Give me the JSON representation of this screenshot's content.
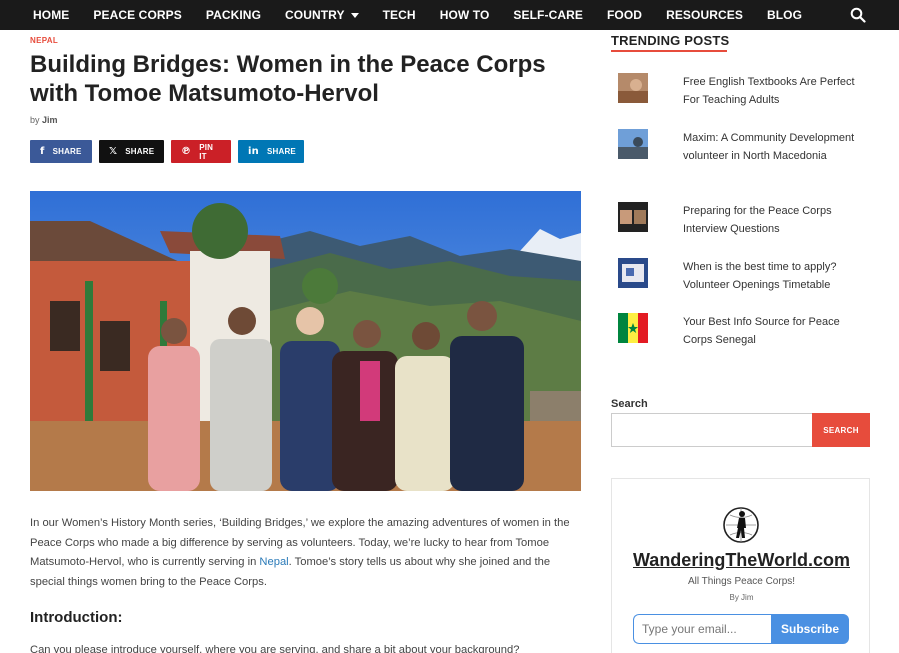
{
  "nav": {
    "items": [
      "HOME",
      "PEACE CORPS",
      "PACKING",
      "COUNTRY",
      "TECH",
      "HOW TO",
      "SELF-CARE",
      "FOOD",
      "RESOURCES",
      "BLOG"
    ]
  },
  "article": {
    "category": "NEPAL",
    "title": "Building Bridges: Women in the Peace Corps with Tomoe Matsumoto-Hervol",
    "byline_prefix": "by",
    "author": "Jim",
    "share": {
      "facebook": "SHARE",
      "x": "SHARE",
      "pinterest": "PIN IT",
      "linkedin": "SHARE"
    },
    "intro_before_link": "In our Women’s History Month series, ‘Building Bridges,’ we explore the amazing adventures of women in the Peace Corps who made a big difference by serving as volunteers. Today, we’re lucky to hear from Tomoe Matsumoto-Hervol, who is currently serving in ",
    "intro_link": "Nepal",
    "intro_after_link": ". Tomoe’s story tells us about why she joined and the special things women bring to the Peace Corps.",
    "section_heading": "Introduction:",
    "question": "Can you please introduce yourself, where you are serving, and share a bit about your background?"
  },
  "sidebar": {
    "trending_title": "TRENDING POSTS",
    "posts": [
      {
        "title": "Free English Textbooks Are Perfect For Teaching Adults"
      },
      {
        "title": "Maxim: A Community Development volunteer in North Macedonia"
      },
      {
        "title": "Preparing for the Peace Corps Interview Questions"
      },
      {
        "title": "When is the best time to apply? Volunteer Openings Timetable"
      },
      {
        "title": "Your Best Info Source for Peace Corps Senegal"
      }
    ],
    "search_label": "Search",
    "search_placeholder": "",
    "search_button": "SEARCH",
    "widget": {
      "site_name": "WanderingTheWorld.com",
      "tagline": "All Things Peace Corps!",
      "byline": "By Jim",
      "email_placeholder": "Type your email...",
      "subscribe_label": "Subscribe"
    }
  },
  "colors": {
    "nav_bg": "#1a1a1a",
    "accent": "#e74c3c",
    "link": "#2a7ab8",
    "facebook": "#3b5998",
    "pinterest": "#cb2027",
    "linkedin": "#0077b5",
    "subscribe": "#4a90e2"
  },
  "icons": [
    "search-icon",
    "chevron-down-icon",
    "facebook-icon",
    "x-icon",
    "pinterest-icon",
    "linkedin-icon",
    "walking-globe-logo"
  ]
}
